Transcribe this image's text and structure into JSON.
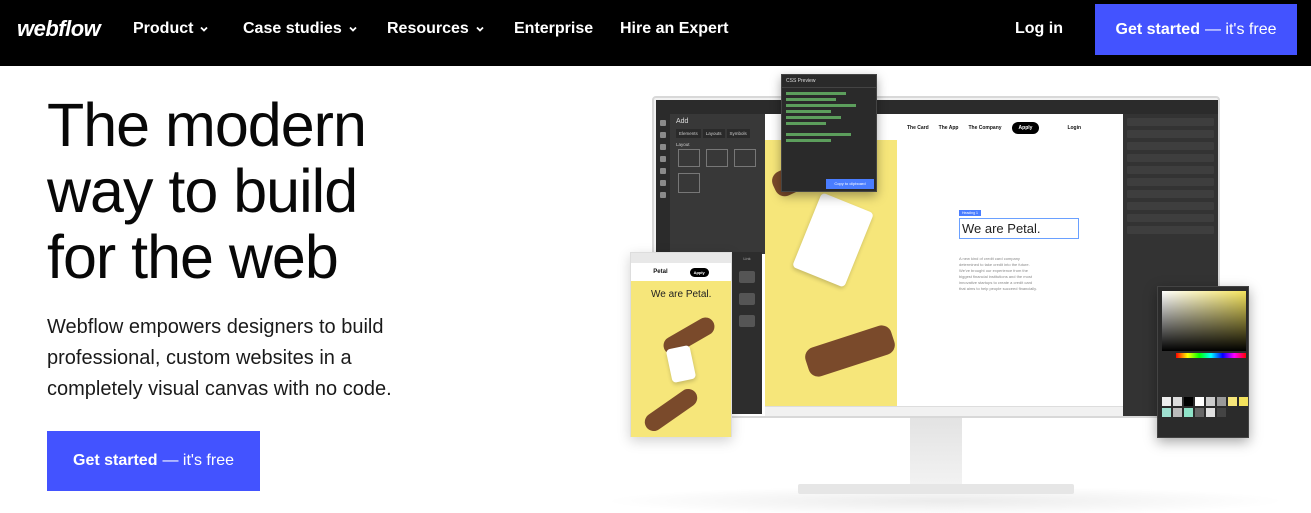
{
  "nav": {
    "logo": "webflow",
    "items": [
      {
        "label": "Product",
        "dropdown": true
      },
      {
        "label": "Case studies",
        "dropdown": true
      },
      {
        "label": "Resources",
        "dropdown": true
      },
      {
        "label": "Enterprise",
        "dropdown": false
      },
      {
        "label": "Hire an Expert",
        "dropdown": false
      }
    ],
    "login": "Log in",
    "cta_strong": "Get started",
    "cta_rest": "— it's free"
  },
  "hero": {
    "title_lines": [
      "The modern",
      "way to build",
      "for the web"
    ],
    "subtitle_lines": [
      "Webflow empowers designers to build",
      "professional, custom websites in a",
      "completely visual canvas with no code."
    ],
    "cta_strong": "Get started",
    "cta_rest": "— it's free"
  },
  "mockup": {
    "add_panel_title": "Add",
    "add_tabs": [
      "Elements",
      "Layouts",
      "Symbols"
    ],
    "add_section": "Layout",
    "css_preview_title": "CSS Preview",
    "css_preview_button": "Copy to clipboard",
    "canvas_nav": [
      "The Card",
      "The App",
      "The Company"
    ],
    "apply_label": "Apply",
    "login_label": "Login",
    "headline_tag": "Heading 1",
    "headline": "We are Petal.",
    "body_text": "A new kind of credit card company determined to take credit into the future. We've brought our experience from the biggest financial institutions and the most innovative startups to create a credit card that aims to help people succeed financially.",
    "phone_brand": "Petal",
    "phone_headline": "We are Petal.",
    "phone_side_label": "Link"
  },
  "colors": {
    "accent": "#4353ff",
    "nav_bg": "#000000",
    "petal_yellow": "#f6e67a"
  }
}
